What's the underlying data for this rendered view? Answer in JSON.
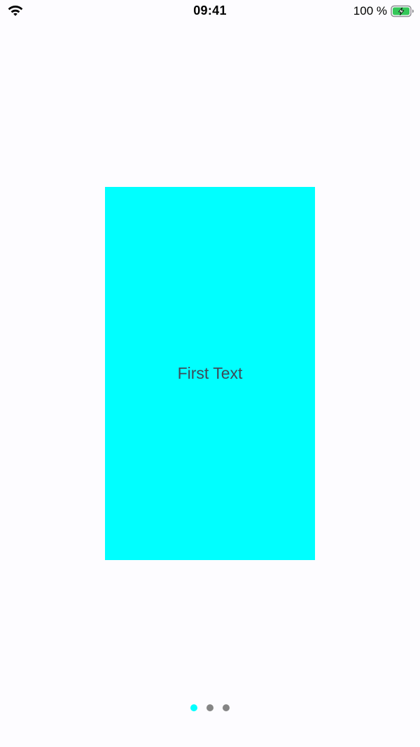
{
  "status_bar": {
    "time": "09:41",
    "battery_percent": "100 %",
    "battery_level": 1.0,
    "battery_color": "#34c759",
    "icons": [
      "wifi-icon",
      "battery-charging-icon"
    ]
  },
  "pager": {
    "pages": [
      {
        "text": "First Text",
        "background": "#00ffff"
      }
    ],
    "current_page": 1,
    "total_pages": 3,
    "active_dot_color": "#00ffff",
    "inactive_dot_color": "#858585"
  }
}
